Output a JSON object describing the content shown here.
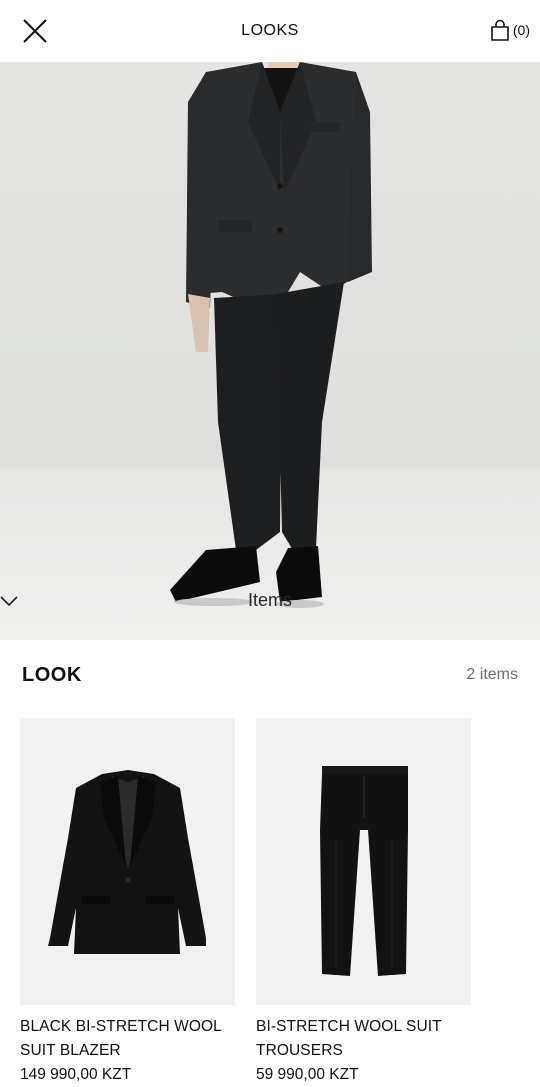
{
  "header": {
    "title": "LOOKS",
    "bag_count": "(0)",
    "close_icon": "close-icon",
    "bag_icon": "shopping-bag-icon"
  },
  "hero": {
    "items_label": "Items",
    "chevron_icon": "chevron-down-icon"
  },
  "look": {
    "title": "LOOK",
    "count": "2 items",
    "products": [
      {
        "name_line1": "BLACK BI-STRETCH WOOL",
        "name_line2": "SUIT BLAZER",
        "price": "149 990,00 KZT"
      },
      {
        "name_line1": "BI-STRETCH WOOL SUIT",
        "name_line2": "TROUSERS",
        "price": "59 990,00 KZT"
      }
    ]
  }
}
